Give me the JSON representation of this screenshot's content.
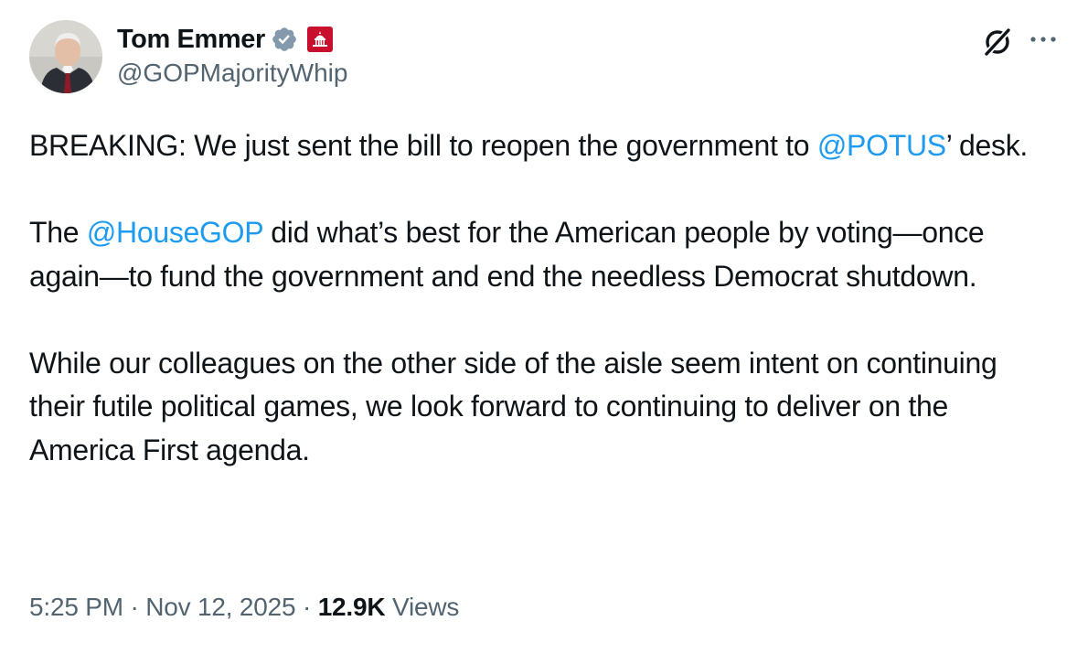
{
  "author": {
    "display_name": "Tom Emmer",
    "handle": "@GOPMajorityWhip",
    "verified": true,
    "affiliate_badge": "capitol-badge-icon"
  },
  "header_actions": {
    "grok_icon": "grok-icon",
    "more_icon": "more-icon"
  },
  "tweet": {
    "paragraphs": [
      {
        "segments": [
          {
            "text": "BREAKING: We just sent the bill to reopen the government to ",
            "type": "text"
          },
          {
            "text": "@POTUS",
            "type": "mention"
          },
          {
            "text": "’ desk.",
            "type": "text"
          }
        ]
      },
      {
        "segments": [
          {
            "text": "The ",
            "type": "text"
          },
          {
            "text": "@HouseGOP",
            "type": "mention"
          },
          {
            "text": " did what’s best for the American people by voting—once again—to fund the government and end the needless Democrat shutdown.",
            "type": "text"
          }
        ]
      },
      {
        "segments": [
          {
            "text": "While our colleagues on the other side of the aisle seem intent on continuing their futile political games, we look forward to continuing to deliver on the America First agenda.",
            "type": "text"
          }
        ]
      }
    ]
  },
  "meta": {
    "time": "5:25 PM",
    "separator": "·",
    "date": "Nov 12, 2025",
    "views_count": "12.9K",
    "views_label": "Views"
  },
  "colors": {
    "link": "#1d9bf0",
    "secondary_text": "#536471",
    "primary_text": "#0f1419",
    "verified_badge": "#829aab",
    "affiliate_red": "#c8102e"
  }
}
